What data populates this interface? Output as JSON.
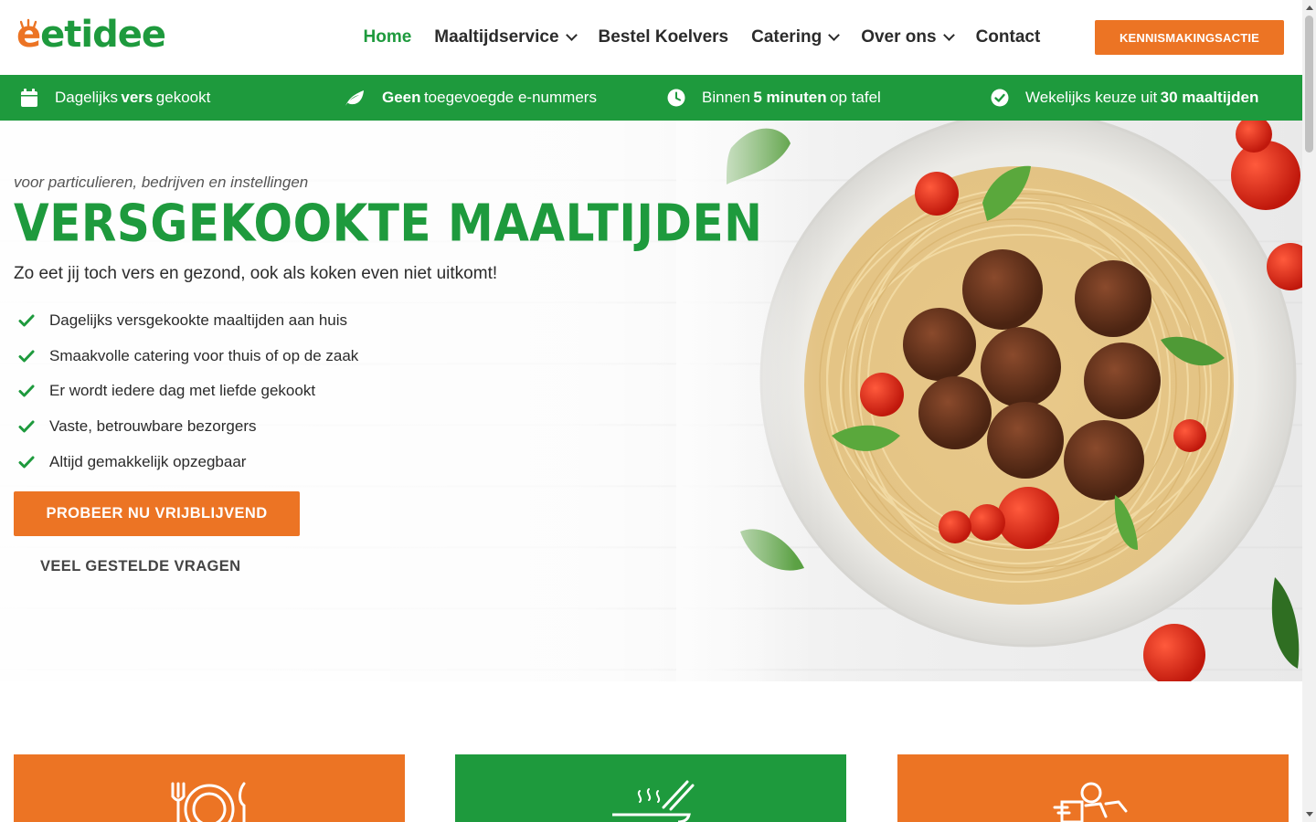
{
  "header": {
    "logo_text_e": "e",
    "logo_text_rest": "etidee",
    "nav": [
      {
        "label": "Home",
        "active": true,
        "dropdown": false
      },
      {
        "label": "Maaltijdservice",
        "active": false,
        "dropdown": true
      },
      {
        "label": "Bestel Koelvers",
        "active": false,
        "dropdown": false
      },
      {
        "label": "Catering",
        "active": false,
        "dropdown": true
      },
      {
        "label": "Over ons",
        "active": false,
        "dropdown": true
      },
      {
        "label": "Contact",
        "active": false,
        "dropdown": false
      }
    ],
    "cta_label": "KENNISMAKINGSACTIE"
  },
  "usp_bar": {
    "items": [
      {
        "icon": "calendar-icon",
        "pre": "Dagelijks ",
        "bold": "vers",
        "post": " gekookt"
      },
      {
        "icon": "leaf-icon",
        "pre": "",
        "bold": "Geen",
        "post": " toegevoegde e-nummers"
      },
      {
        "icon": "clock-icon",
        "pre": "Binnen ",
        "bold": "5 minuten",
        "post": " op tafel"
      },
      {
        "icon": "check-circle-icon",
        "pre": "Wekelijks keuze uit ",
        "bold": "30 maaltijden",
        "post": ""
      }
    ]
  },
  "hero": {
    "eyebrow": "voor particulieren, bedrijven en instellingen",
    "title": "VERSGEKOOKTE MAALTIJDEN",
    "subtitle": "Zo eet jij toch vers en gezond, ook als koken even niet uitkomt!",
    "checklist": [
      "Dagelijks versgekookte maaltijden aan huis",
      "Smaakvolle catering voor thuis of op de zaak",
      "Er wordt iedere dag met liefde gekookt",
      "Vaste, betrouwbare bezorgers",
      "Altijd gemakkelijk opzegbaar"
    ],
    "primary_button": "PROBEER NU VRIJBLIJVEND",
    "secondary_button": "VEEL GESTELDE VRAGEN"
  },
  "cards": [
    {
      "icon": "plate-cutlery-icon",
      "color": "#ec7424"
    },
    {
      "icon": "soup-bowl-icon",
      "color": "#1e9a3d"
    },
    {
      "icon": "delivery-scooter-icon",
      "color": "#ec7424"
    }
  ],
  "colors": {
    "brand_orange": "#ec7424",
    "brand_green": "#1e9a3d",
    "text_dark": "#2b2b2b"
  }
}
